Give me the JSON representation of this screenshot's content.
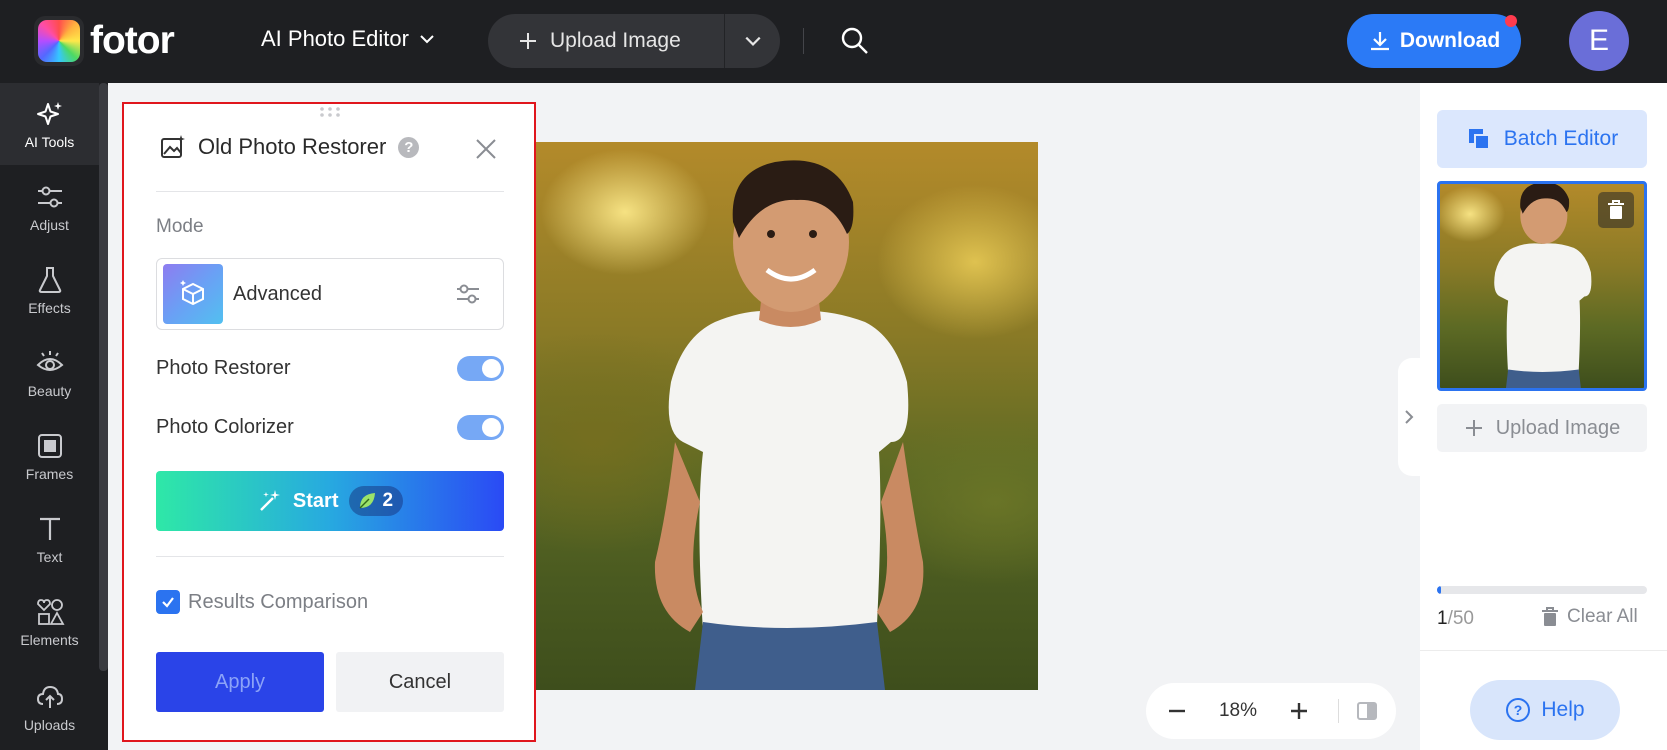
{
  "header": {
    "logo_text": "fotor",
    "menu_title": "AI Photo Editor",
    "upload_label": "Upload Image",
    "download_label": "Download",
    "avatar_initial": "E"
  },
  "sidebar": {
    "items": [
      {
        "label": "AI Tools",
        "icon": "sparkle-icon",
        "active": true
      },
      {
        "label": "Adjust",
        "icon": "sliders-icon"
      },
      {
        "label": "Effects",
        "icon": "flask-icon"
      },
      {
        "label": "Beauty",
        "icon": "eye-icon"
      },
      {
        "label": "Frames",
        "icon": "frame-icon"
      },
      {
        "label": "Text",
        "icon": "text-icon"
      },
      {
        "label": "Elements",
        "icon": "shapes-icon"
      },
      {
        "label": "Uploads",
        "icon": "cloud-upload-icon"
      }
    ]
  },
  "tool_panel": {
    "title": "Old Photo Restorer",
    "help_glyph": "?",
    "mode_label": "Mode",
    "mode_value": "Advanced",
    "toggles": [
      {
        "label": "Photo Restorer",
        "on": true
      },
      {
        "label": "Photo Colorizer",
        "on": true
      }
    ],
    "start_label": "Start",
    "credits": "2",
    "results_comparison_label": "Results Comparison",
    "results_comparison_checked": true,
    "apply_label": "Apply",
    "cancel_label": "Cancel"
  },
  "canvas": {
    "zoom_value": "18%"
  },
  "right_panel": {
    "batch_editor_label": "Batch Editor",
    "upload_label": "Upload Image",
    "count_current": "1",
    "count_total": "/50",
    "progress_fraction": 0.02,
    "clear_all_label": "Clear All",
    "help_label": "Help"
  },
  "colors": {
    "accent": "#2b7af6",
    "selection_border": "#e0161d",
    "topbar": "#1e1f22"
  }
}
